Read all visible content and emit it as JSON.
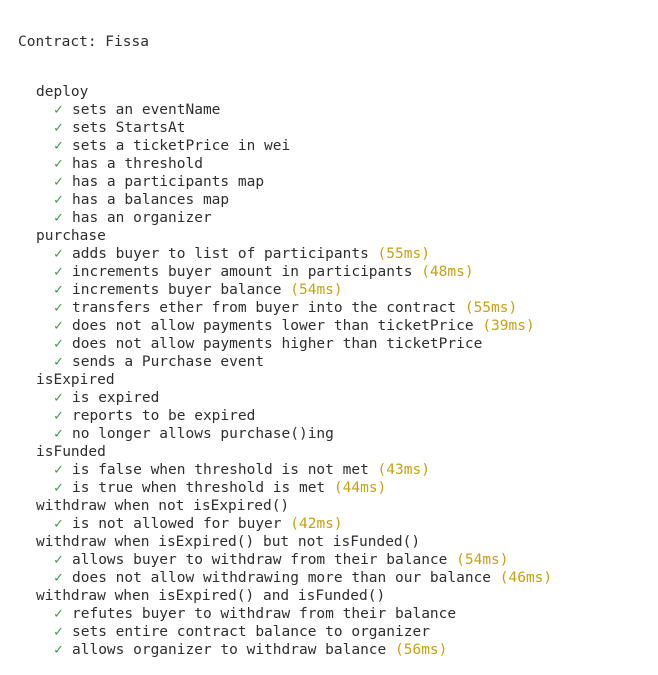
{
  "terminal": {
    "contract_line": "Contract: Fissa",
    "check_glyph": "✓",
    "colors": {
      "text": "#2e2e2e",
      "check": "#3a9a4a",
      "duration": "#c8a014",
      "background": "#ffffff"
    },
    "suites": [
      {
        "name": "deploy",
        "tests": [
          {
            "title": "sets an eventName",
            "duration": ""
          },
          {
            "title": "sets StartsAt",
            "duration": ""
          },
          {
            "title": "sets a ticketPrice in wei",
            "duration": ""
          },
          {
            "title": "has a threshold",
            "duration": ""
          },
          {
            "title": "has a participants map",
            "duration": ""
          },
          {
            "title": "has a balances map",
            "duration": ""
          },
          {
            "title": "has an organizer",
            "duration": ""
          }
        ]
      },
      {
        "name": "purchase",
        "tests": [
          {
            "title": "adds buyer to list of participants",
            "duration": "(55ms)"
          },
          {
            "title": "increments buyer amount in participants",
            "duration": "(48ms)"
          },
          {
            "title": "increments buyer balance",
            "duration": "(54ms)"
          },
          {
            "title": "transfers ether from buyer into the contract",
            "duration": "(55ms)"
          },
          {
            "title": "does not allow payments lower than ticketPrice",
            "duration": "(39ms)"
          },
          {
            "title": "does not allow payments higher than ticketPrice",
            "duration": ""
          },
          {
            "title": "sends a Purchase event",
            "duration": ""
          }
        ]
      },
      {
        "name": "isExpired",
        "tests": [
          {
            "title": "is expired",
            "duration": ""
          },
          {
            "title": "reports to be expired",
            "duration": ""
          },
          {
            "title": "no longer allows purchase()ing",
            "duration": ""
          }
        ]
      },
      {
        "name": "isFunded",
        "tests": [
          {
            "title": "is false when threshold is not met",
            "duration": "(43ms)"
          },
          {
            "title": "is true when threshold is met",
            "duration": "(44ms)"
          }
        ]
      },
      {
        "name": "withdraw when not isExpired()",
        "tests": [
          {
            "title": "is not allowed for buyer",
            "duration": "(42ms)"
          }
        ]
      },
      {
        "name": "withdraw when isExpired() but not isFunded()",
        "tests": [
          {
            "title": "allows buyer to withdraw from their balance",
            "duration": "(54ms)"
          },
          {
            "title": "does not allow withdrawing more than our balance",
            "duration": "(46ms)"
          }
        ]
      },
      {
        "name": "withdraw when isExpired() and isFunded()",
        "tests": [
          {
            "title": "refutes buyer to withdraw from their balance",
            "duration": ""
          },
          {
            "title": "sets entire contract balance to organizer",
            "duration": ""
          },
          {
            "title": "allows organizer to withdraw balance",
            "duration": "(56ms)"
          }
        ]
      }
    ]
  }
}
